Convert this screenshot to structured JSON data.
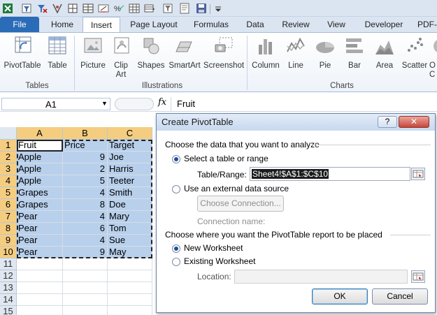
{
  "qat": {
    "icons": [
      "excel-logo-icon",
      "autofilter-icon",
      "clear-filter-icon",
      "remove-duplicates-icon",
      "borders-icon",
      "merge-icon",
      "percent-icon",
      "conditional-format-icon",
      "save-icon",
      "undo-icon",
      "customize-icon"
    ]
  },
  "tabs": [
    "File",
    "Home",
    "Insert",
    "Page Layout",
    "Formulas",
    "Data",
    "Review",
    "View",
    "Developer",
    "PDF-"
  ],
  "ribbon": {
    "groups": [
      {
        "label": "Tables",
        "buttons": [
          "PivotTable",
          "Table"
        ]
      },
      {
        "label": "Illustrations",
        "buttons": [
          "Picture",
          "Clip Art",
          "Shapes",
          "SmartArt",
          "Screenshot"
        ]
      },
      {
        "label": "Charts",
        "buttons": [
          "Column",
          "Line",
          "Pie",
          "Bar",
          "Area",
          "Scatter",
          "O C"
        ]
      }
    ],
    "clip_art_line2": "Art",
    "clip_art_line1": "Clip",
    "other_charts_line1": "O",
    "other_charts_line2": "C"
  },
  "formula_bar": {
    "name_box": "A1",
    "fx": "fx",
    "value": "Fruit"
  },
  "sheet": {
    "columns": [
      "A",
      "B",
      "C"
    ],
    "rows": [
      "1",
      "2",
      "3",
      "4",
      "5",
      "6",
      "7",
      "8",
      "9",
      "10",
      "11",
      "12",
      "13",
      "14",
      "15"
    ],
    "data": [
      [
        "Fruit",
        "Price",
        "Target"
      ],
      [
        "Apple",
        "9",
        "Joe"
      ],
      [
        "Apple",
        "2",
        "Harris"
      ],
      [
        "Apple",
        "5",
        "Teeter"
      ],
      [
        "Grapes",
        "4",
        "Smith"
      ],
      [
        "Grapes",
        "8",
        "Doe"
      ],
      [
        "Pear",
        "4",
        "Mary"
      ],
      [
        "Pear",
        "6",
        "Tom"
      ],
      [
        "Pear",
        "4",
        "Sue"
      ],
      [
        "Pear",
        "9",
        "May"
      ]
    ]
  },
  "dialog": {
    "title": "Create PivotTable",
    "help": "?",
    "close": "✕",
    "section1": "Choose the data that you want to analyze",
    "opt_select_table": "Select a table or range",
    "table_range_label": "Table/Range:",
    "table_range_value": "Sheet4!$A$1:$C$10",
    "opt_external": "Use an external data source",
    "choose_connection": "Choose Connection...",
    "connection_name": "Connection name:",
    "section2": "Choose where you want the PivotTable report to be placed",
    "opt_new_ws": "New Worksheet",
    "opt_existing_ws": "Existing Worksheet",
    "location_label": "Location:",
    "location_value": "",
    "ok": "OK",
    "cancel": "Cancel"
  }
}
